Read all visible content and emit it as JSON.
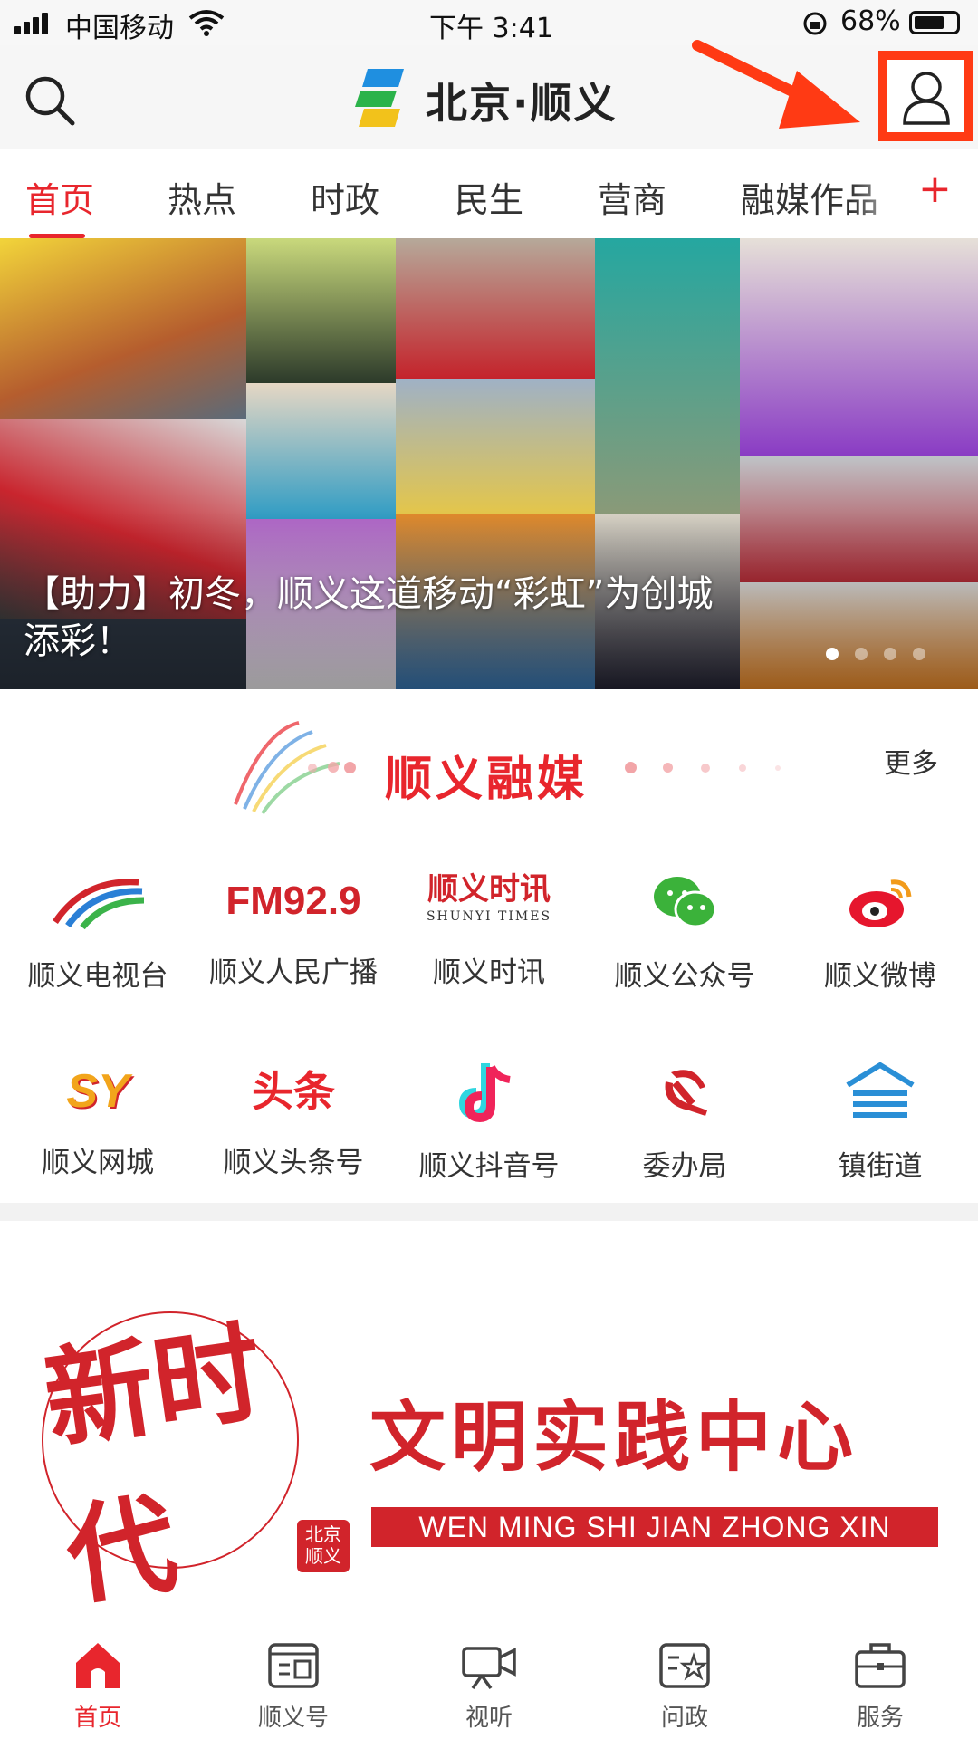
{
  "status_bar": {
    "carrier": "中国移动",
    "time": "下午 3:41",
    "battery": "68%"
  },
  "header": {
    "logo_text": "北京·顺义",
    "search_icon": "search-icon",
    "profile_icon": "user-profile-icon",
    "highlight_color": "#ff3a14"
  },
  "tabs": [
    {
      "label": "首页",
      "active": true
    },
    {
      "label": "热点"
    },
    {
      "label": "时政"
    },
    {
      "label": "民生"
    },
    {
      "label": "营商"
    },
    {
      "label": "融媒作品"
    }
  ],
  "add_tab": "+",
  "banner": {
    "caption": "【助力】初冬，顺义这道移动“彩虹”为创城添彩！",
    "slide_count": 4,
    "active_slide": 1
  },
  "media_section": {
    "title": "顺义融媒",
    "more": "更多"
  },
  "media_items": [
    {
      "label": "顺义电视台",
      "icon": "tv-station-logo-icon"
    },
    {
      "label": "顺义人民广播",
      "icon_text": "FM92.9"
    },
    {
      "label": "顺义时讯",
      "icon_text": "顺义时讯",
      "icon_subtext": "SHUNYI TIMES"
    },
    {
      "label": "顺义公众号",
      "icon": "wechat-icon"
    },
    {
      "label": "顺义微博",
      "icon": "weibo-icon"
    },
    {
      "label": "顺义网城",
      "icon_text": "SY"
    },
    {
      "label": "顺义头条号",
      "icon_text": "头条"
    },
    {
      "label": "顺义抖音号",
      "icon": "douyin-icon"
    },
    {
      "label": "委办局",
      "icon": "party-emblem-icon"
    },
    {
      "label": "镇街道",
      "icon": "town-street-icon"
    }
  ],
  "promo": {
    "calligraphy": "新时代",
    "title": "文明实践中心",
    "subtitle": "WEN MING SHI JIAN ZHONG XIN",
    "seal": "北京顺义"
  },
  "bottom_nav": [
    {
      "label": "首页",
      "icon": "home-icon",
      "active": true
    },
    {
      "label": "顺义号",
      "icon": "news-account-icon"
    },
    {
      "label": "视听",
      "icon": "video-camera-icon"
    },
    {
      "label": "问政",
      "icon": "inquiry-icon"
    },
    {
      "label": "服务",
      "icon": "briefcase-icon"
    }
  ],
  "colors": {
    "accent": "#e8262d",
    "promo_red": "#d1242b"
  }
}
